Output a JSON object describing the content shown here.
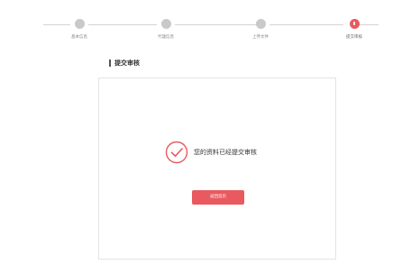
{
  "stepper": {
    "steps": [
      {
        "label": "基本信息",
        "state": "done"
      },
      {
        "label": "代理信息",
        "state": "done"
      },
      {
        "label": "上传文件",
        "state": "done"
      },
      {
        "label": "提交审核",
        "state": "current"
      }
    ]
  },
  "section": {
    "title": "提交审核"
  },
  "status": {
    "icon": "check-circle-icon",
    "message": "您的资料已经提交审核"
  },
  "actions": {
    "return_label": "返回首页"
  },
  "colors": {
    "accent": "#e85a5f",
    "inactive_step": "#c9c9c9",
    "line": "#d4d4d4"
  }
}
